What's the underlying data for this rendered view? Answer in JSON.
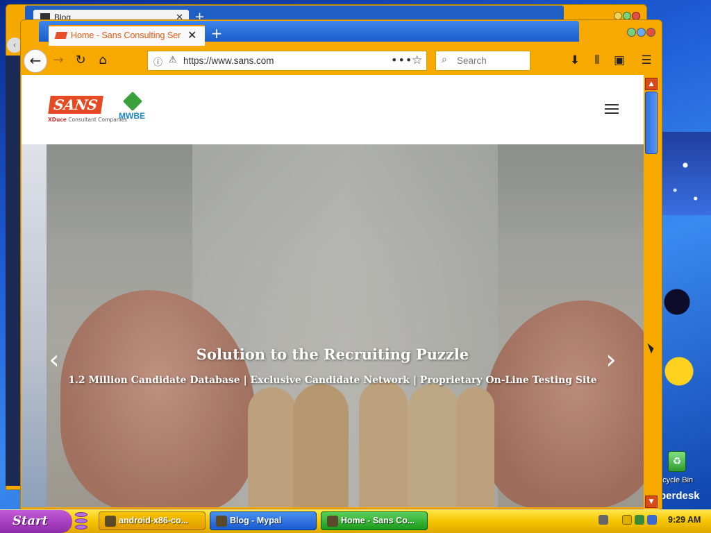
{
  "background_window": {
    "tab_label": "Blog",
    "tab_close": "✕",
    "new_tab": "+"
  },
  "browser": {
    "tab": {
      "title": "Home - Sans Consulting Ser",
      "close": "✕"
    },
    "new_tab": "+",
    "nav": {
      "back": "←",
      "forward": "→",
      "reload": "↻",
      "home": "⌂"
    },
    "url": {
      "value": "https://www.sans.com",
      "info_glyph": "ⓘ",
      "lock_glyph": "🔒",
      "more_glyph": "•••",
      "bookmark_glyph": "☆"
    },
    "search": {
      "placeholder": "Search",
      "glyph": "⌕"
    },
    "toolbar_icons": {
      "download": "⬇",
      "library": "⫴",
      "sidebar": "▣",
      "menu": "☰"
    }
  },
  "site": {
    "logo_text": "SANS",
    "logo_sub": "XDuce",
    "logo_sub_rest": "Consultant Companies",
    "partner_logo": "MWBE",
    "hero": {
      "title": "Solution to the Recruiting Puzzle",
      "subtitle": "1.2 Million Candidate Database | Exclusive Candidate Network | Proprietary On-Line Testing Site",
      "prev": "‹",
      "next": "›"
    }
  },
  "scrollbar": {
    "up": "▲",
    "down": "▼"
  },
  "desktop": {
    "recycle_label": "ecycle Bin",
    "brand_text": "perdesk"
  },
  "taskbar": {
    "start_label": "Start",
    "tasks": [
      {
        "label": "android-x86-co..."
      },
      {
        "label": "Blog - Mypal"
      },
      {
        "label": "Home - Sans Co..."
      }
    ],
    "clock": "9:29 AM"
  },
  "colors": {
    "window_frame": "#f7a900",
    "tab_strip": "#1a5cc8",
    "tab_accent": "#e0560f",
    "logo_red": "#e64a25",
    "taskbar_yellow": "#f5c400",
    "start_purple": "#8e2aa8"
  }
}
